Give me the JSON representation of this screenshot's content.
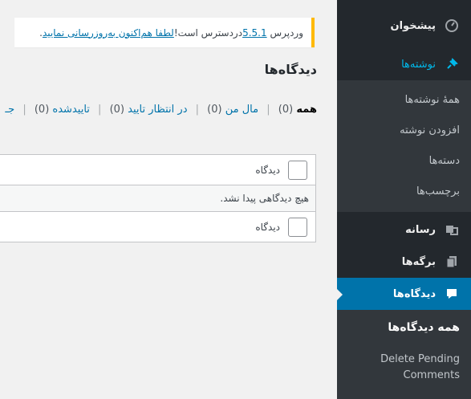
{
  "notice": {
    "prefix": "وردپرس",
    "version": "5.5.1",
    "middle": " دردسترس است! ",
    "link": "لطفا هم‌اکنون به‌روزرسانی نمایید",
    "suffix": "."
  },
  "page": {
    "title": "دیدگاه‌ها"
  },
  "filters": [
    {
      "label": "همه",
      "count": "(0)",
      "current": true
    },
    {
      "label": "مال من",
      "count": "(0)"
    },
    {
      "label": "در انتظار تایید",
      "count": "(0)"
    },
    {
      "label": "تاییدشده",
      "count": "(0)"
    },
    {
      "label": "جـ",
      "count": ""
    }
  ],
  "table": {
    "column_label": "دیدگاه",
    "empty_message": "هیچ دیدگاهی پیدا نشد."
  },
  "sidebar": {
    "dashboard": {
      "label": "پیشخوان",
      "icon": "dashboard-icon"
    },
    "posts": {
      "label": "نوشته‌ها",
      "icon": "pin-icon"
    },
    "posts_sub": [
      "همهٔ نوشته‌ها",
      "افزودن نوشته",
      "دسته‌ها",
      "برچسب‌ها"
    ],
    "media": {
      "label": "رسانه",
      "icon": "media-icon"
    },
    "pages": {
      "label": "برگه‌ها",
      "icon": "pages-icon"
    },
    "comments": {
      "label": "دیدگاه‌ها",
      "icon": "comment-icon"
    },
    "comments_sub": [
      "همه دیدگاه‌ها",
      "Delete Pending Comments"
    ]
  },
  "colors": {
    "sidebar_bg": "#23282d",
    "submenu_bg": "#32373c",
    "accent": "#0073aa",
    "notice_border": "#ffb900"
  }
}
